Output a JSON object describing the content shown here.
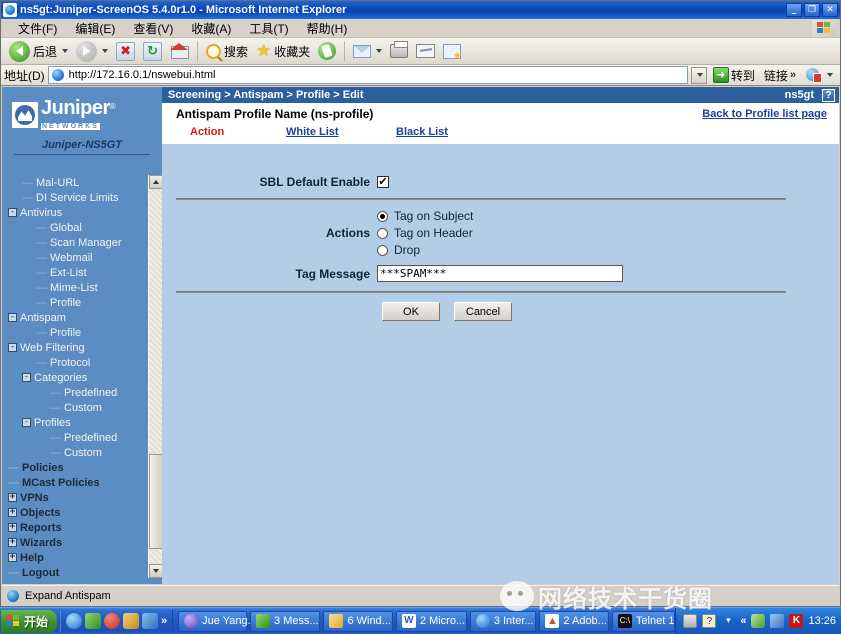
{
  "window": {
    "title": "ns5gt:Juniper-ScreenOS 5.4.0r1.0 - Microsoft Internet Explorer",
    "minimize": "_",
    "restore": "❐",
    "close": "✕"
  },
  "menubar": {
    "items": [
      {
        "label": "文件(F)"
      },
      {
        "label": "编辑(E)"
      },
      {
        "label": "查看(V)"
      },
      {
        "label": "收藏(A)"
      },
      {
        "label": "工具(T)"
      },
      {
        "label": "帮助(H)"
      }
    ]
  },
  "toolbar": {
    "back": "后退",
    "forward": "",
    "stop": "✖",
    "refresh": "↻",
    "home": "",
    "search": "搜索",
    "favorites": "收藏夹",
    "history": "",
    "mail": "",
    "print": "",
    "edit": "",
    "discuss": ""
  },
  "addressbar": {
    "label": "地址(D)",
    "url": "http://172.16.0.1/nswebui.html",
    "go": "转到",
    "links": "链接",
    "chevron": "»"
  },
  "sidebar": {
    "brand": "Juniper",
    "brand_sub": "NETWORKS",
    "brand_reg": "®",
    "device": "Juniper-NS5GT",
    "items": [
      {
        "label": "Mal-URL",
        "indent": 1,
        "toggle": "",
        "bold": false
      },
      {
        "label": "DI Service Limits",
        "indent": 1,
        "toggle": "",
        "bold": false
      },
      {
        "label": "Antivirus",
        "indent": 0,
        "toggle": "-",
        "bold": false
      },
      {
        "label": "Global",
        "indent": 2,
        "toggle": "",
        "bold": false
      },
      {
        "label": "Scan Manager",
        "indent": 2,
        "toggle": "",
        "bold": false
      },
      {
        "label": "Webmail",
        "indent": 2,
        "toggle": "",
        "bold": false
      },
      {
        "label": "Ext-List",
        "indent": 2,
        "toggle": "",
        "bold": false
      },
      {
        "label": "Mime-List",
        "indent": 2,
        "toggle": "",
        "bold": false
      },
      {
        "label": "Profile",
        "indent": 2,
        "toggle": "",
        "bold": false
      },
      {
        "label": "Antispam",
        "indent": 0,
        "toggle": "-",
        "bold": false
      },
      {
        "label": "Profile",
        "indent": 2,
        "toggle": "",
        "bold": false
      },
      {
        "label": "Web Filtering",
        "indent": 0,
        "toggle": "-",
        "bold": false
      },
      {
        "label": "Protocol",
        "indent": 2,
        "toggle": "",
        "bold": false
      },
      {
        "label": "Categories",
        "indent": 1,
        "toggle": "-",
        "bold": false
      },
      {
        "label": "Predefined",
        "indent": 3,
        "toggle": "",
        "bold": false
      },
      {
        "label": "Custom",
        "indent": 3,
        "toggle": "",
        "bold": false
      },
      {
        "label": "Profiles",
        "indent": 1,
        "toggle": "-",
        "bold": false
      },
      {
        "label": "Predefined",
        "indent": 3,
        "toggle": "",
        "bold": false
      },
      {
        "label": "Custom",
        "indent": 3,
        "toggle": "",
        "bold": false
      },
      {
        "label": "Policies",
        "indent": 0,
        "toggle": "",
        "bold": true
      },
      {
        "label": "MCast Policies",
        "indent": 0,
        "toggle": "",
        "bold": true
      },
      {
        "label": "VPNs",
        "indent": 0,
        "toggle": "+",
        "bold": true
      },
      {
        "label": "Objects",
        "indent": 0,
        "toggle": "+",
        "bold": true
      },
      {
        "label": "Reports",
        "indent": 0,
        "toggle": "+",
        "bold": true
      },
      {
        "label": "Wizards",
        "indent": 0,
        "toggle": "+",
        "bold": true
      },
      {
        "label": "Help",
        "indent": 0,
        "toggle": "+",
        "bold": true
      },
      {
        "label": "Logout",
        "indent": 0,
        "toggle": "",
        "bold": true
      }
    ]
  },
  "content": {
    "breadcrumb": "Screening > Antispam > Profile > Edit",
    "device_tag": "ns5gt",
    "help_label": "?",
    "profile_name": "Antispam Profile Name (ns-profile)",
    "back_link": "Back to Profile list page",
    "tabs": [
      {
        "label": "Action",
        "active": true
      },
      {
        "label": "White List",
        "active": false
      },
      {
        "label": "Black List",
        "active": false
      }
    ],
    "form": {
      "sbl_label": "SBL Default Enable",
      "sbl_checked": true,
      "sbl_check_glyph": "✔",
      "actions_label": "Actions",
      "actions_options": [
        {
          "label": "Tag on Subject",
          "selected": true
        },
        {
          "label": "Tag on Header",
          "selected": false
        },
        {
          "label": "Drop",
          "selected": false
        }
      ],
      "tag_message_label": "Tag Message",
      "tag_message_value": "***SPAM***",
      "ok_label": "OK",
      "cancel_label": "Cancel"
    }
  },
  "statusbar": {
    "text": "Expand Antispam"
  },
  "taskbar": {
    "start": "开始",
    "quicklaunch_chevron": "»",
    "tasks": [
      {
        "label": "Jue Yang...",
        "color": "#7a5fd0",
        "caret": false
      },
      {
        "label": "3 Mess...",
        "color": "#5fae4a",
        "caret": true
      },
      {
        "label": "6 Wind...",
        "color": "#e0b44a",
        "caret": true
      },
      {
        "label": "2 Micro...",
        "color": "#2b5fd0",
        "caret": true
      },
      {
        "label": "3 Inter...",
        "color": "#4aa8e0",
        "caret": true
      },
      {
        "label": "2 Adob...",
        "color": "#d04a3a",
        "caret": true
      },
      {
        "label": "Telnet 1...",
        "color": "#111111",
        "caret": false
      }
    ],
    "tray_chevron": "«",
    "clock": "13:26"
  },
  "watermark": {
    "text": "网络技术干货圈"
  },
  "colors": {
    "titlebar_blue": "#0a46b0",
    "nav_blue": "#5b8dc2",
    "crumb_blue": "#2d5f9e",
    "body_blue": "#b3cde7",
    "active_tab_red": "#d81a1a",
    "link_blue": "#1a3fa0"
  }
}
